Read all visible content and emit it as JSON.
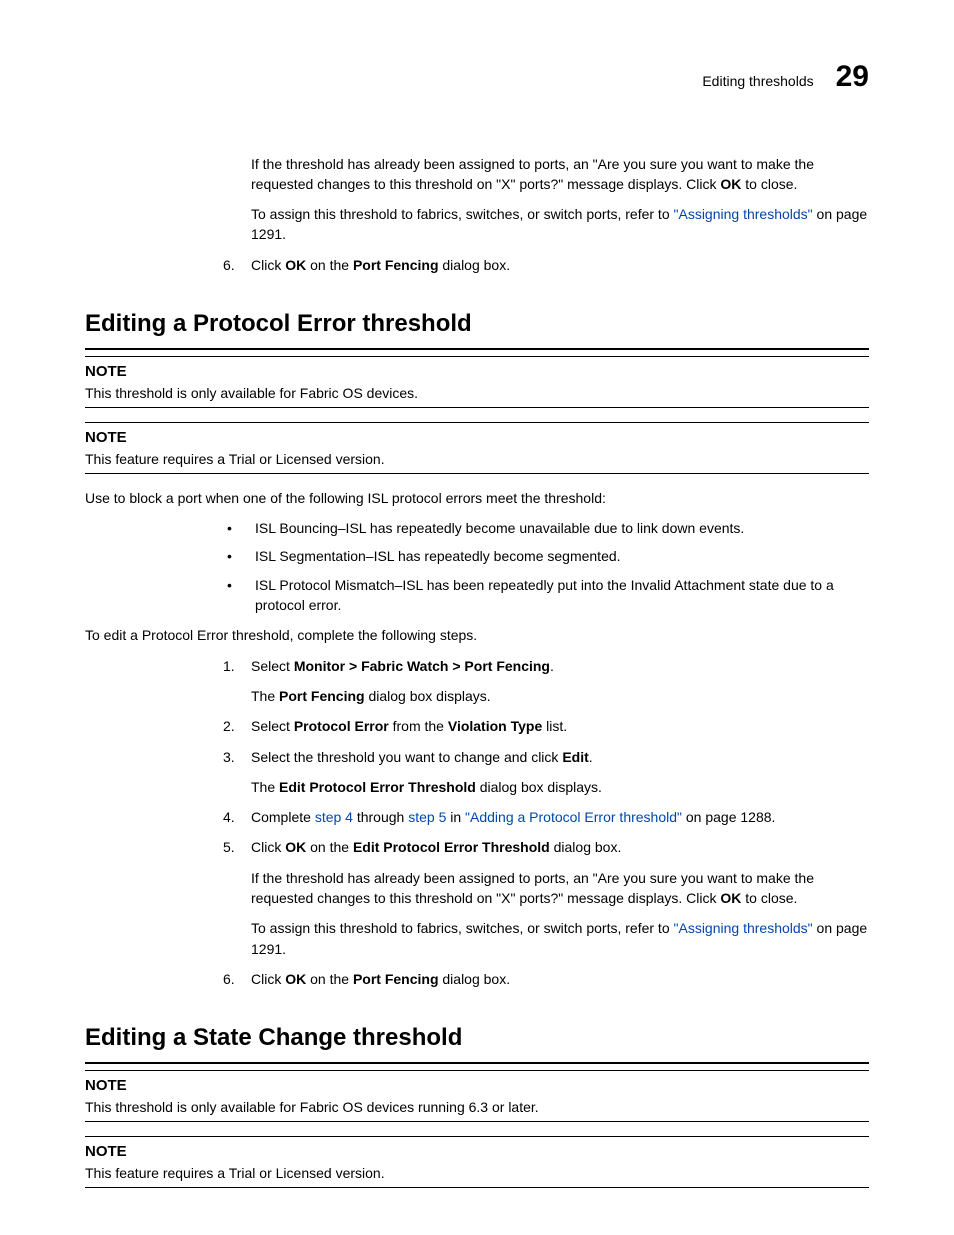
{
  "header": {
    "label": "Editing thresholds",
    "chapter": "29"
  },
  "top": {
    "p1a": "If the threshold has already been assigned to ports, an \"Are you sure you want to make the requested changes to this threshold on \"X\" ports?\" message displays. Click ",
    "p1b": "OK",
    "p1c": " to close.",
    "p2a": "To assign this threshold to fabrics, switches, or switch ports, refer to ",
    "p2link": "\"Assigning thresholds\"",
    "p2b": " on page 1291.",
    "s6num": "6.",
    "s6a": "Click ",
    "s6b": "OK",
    "s6c": " on the ",
    "s6d": "Port Fencing",
    "s6e": " dialog box."
  },
  "sec1": {
    "title": "Editing a Protocol Error threshold",
    "note1_label": "NOTE",
    "note1_text": "This threshold is only available for Fabric OS devices.",
    "note2_label": "NOTE",
    "note2_text": "This feature requires a Trial or Licensed version.",
    "intro": "Use to block a port when one of the following ISL protocol errors meet the threshold:",
    "b1": "ISL Bouncing–ISL has repeatedly become unavailable due to link down events.",
    "b2": "ISL Segmentation–ISL has repeatedly become segmented.",
    "b3": "ISL Protocol Mismatch–ISL has been repeatedly put into the Invalid Attachment state due to a protocol error.",
    "intro2": "To edit a Protocol Error threshold, complete the following steps.",
    "s1num": "1.",
    "s1a": "Select ",
    "s1b": "Monitor > Fabric Watch > Port Fencing",
    "s1c": ".",
    "s1p2a": "The ",
    "s1p2b": "Port Fencing",
    "s1p2c": " dialog box displays.",
    "s2num": "2.",
    "s2a": "Select ",
    "s2b": "Protocol Error",
    "s2c": " from the ",
    "s2d": "Violation Type",
    "s2e": " list.",
    "s3num": "3.",
    "s3a": "Select the threshold you want to change and click ",
    "s3b": "Edit",
    "s3c": ".",
    "s3p2a": "The ",
    "s3p2b": "Edit Protocol Error Threshold",
    "s3p2c": " dialog box displays.",
    "s4num": "4.",
    "s4a": "Complete ",
    "s4link1": "step 4",
    "s4b": " through ",
    "s4link2": "step 5",
    "s4c": " in ",
    "s4link3": "\"Adding a Protocol Error threshold\"",
    "s4d": " on page 1288.",
    "s5num": "5.",
    "s5a": "Click ",
    "s5b": "OK",
    "s5c": " on the ",
    "s5d": "Edit Protocol Error Threshold",
    "s5e": " dialog box.",
    "s5p2a": "If the threshold has already been assigned to ports, an \"Are you sure you want to make the requested changes to this threshold on \"X\" ports?\" message displays. Click ",
    "s5p2b": "OK",
    "s5p2c": " to close.",
    "s5p3a": "To assign this threshold to fabrics, switches, or switch ports, refer to ",
    "s5p3link": "\"Assigning thresholds\"",
    "s5p3b": " on page 1291.",
    "s6num": "6.",
    "s6a": "Click ",
    "s6b": "OK",
    "s6c": " on the ",
    "s6d": "Port Fencing",
    "s6e": " dialog box."
  },
  "sec2": {
    "title": "Editing a State Change threshold",
    "note1_label": "NOTE",
    "note1_text": "This threshold is only available for Fabric OS devices running 6.3 or later.",
    "note2_label": "NOTE",
    "note2_text": "This feature requires a Trial or Licensed version."
  }
}
